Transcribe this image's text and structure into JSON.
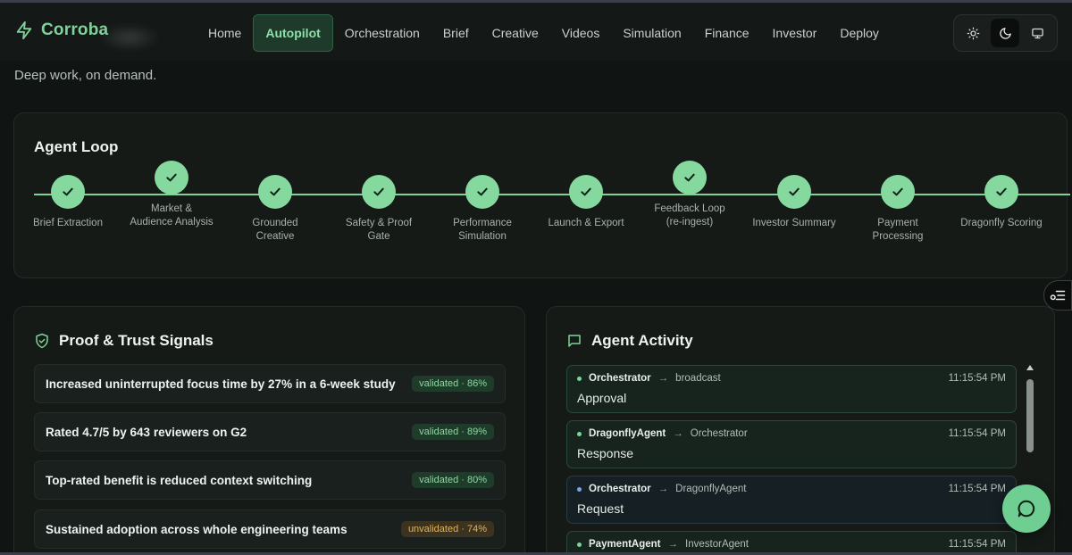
{
  "brand": {
    "name": "Corroba",
    "logo_icon": "zap-icon",
    "accent": "#7fd39a"
  },
  "nav": {
    "items": [
      {
        "label": "Home",
        "active": false
      },
      {
        "label": "Autopilot",
        "active": true
      },
      {
        "label": "Orchestration",
        "active": false
      },
      {
        "label": "Brief",
        "active": false
      },
      {
        "label": "Creative",
        "active": false
      },
      {
        "label": "Videos",
        "active": false
      },
      {
        "label": "Simulation",
        "active": false
      },
      {
        "label": "Finance",
        "active": false
      },
      {
        "label": "Investor",
        "active": false
      },
      {
        "label": "Deploy",
        "active": false
      }
    ]
  },
  "theme": {
    "options": [
      "sun-icon",
      "moon-icon",
      "monitor-icon"
    ],
    "selected": "moon-icon"
  },
  "tagline": "Deep work, on demand.",
  "agent_loop": {
    "title": "Agent Loop",
    "steps": [
      {
        "label": "Brief Extraction",
        "status": "done"
      },
      {
        "label": "Market & Audience Analysis",
        "status": "done"
      },
      {
        "label": "Grounded Creative",
        "status": "done"
      },
      {
        "label": "Safety & Proof Gate",
        "status": "done"
      },
      {
        "label": "Performance Simulation",
        "status": "done"
      },
      {
        "label": "Launch & Export",
        "status": "done"
      },
      {
        "label": "Feedback Loop (re-ingest)",
        "status": "done"
      },
      {
        "label": "Investor Summary",
        "status": "done"
      },
      {
        "label": "Payment Processing",
        "status": "done"
      },
      {
        "label": "Dragonfly Scoring",
        "status": "done"
      }
    ]
  },
  "proof": {
    "title": "Proof & Trust Signals",
    "icon": "shield-check-icon",
    "signals": [
      {
        "text": "Increased uninterrupted focus time by 27% in a 6-week study",
        "badge": "validated · 86%",
        "state": "validated"
      },
      {
        "text": "Rated 4.7/5 by 643 reviewers on G2",
        "badge": "validated · 89%",
        "state": "validated"
      },
      {
        "text": "Top-rated benefit is reduced context switching",
        "badge": "validated · 80%",
        "state": "validated"
      },
      {
        "text": "Sustained adoption across whole engineering teams",
        "badge": "unvalidated · 74%",
        "state": "unvalidated"
      }
    ]
  },
  "activity": {
    "title": "Agent Activity",
    "icon": "message-square-icon",
    "arrow": "→",
    "events": [
      {
        "from": "Orchestrator",
        "to": "broadcast",
        "time": "11:15:54 PM",
        "kind": "Approval",
        "tone": "green"
      },
      {
        "from": "DragonflyAgent",
        "to": "Orchestrator",
        "time": "11:15:54 PM",
        "kind": "Response",
        "tone": "green"
      },
      {
        "from": "Orchestrator",
        "to": "DragonflyAgent",
        "time": "11:15:54 PM",
        "kind": "Request",
        "tone": "blue"
      },
      {
        "from": "PaymentAgent",
        "to": "InvestorAgent",
        "time": "11:15:54 PM",
        "kind": "",
        "tone": "green"
      }
    ]
  },
  "chat_button_icon": "chat-bubble-icon",
  "side_handle_icon": "settings-list-icon"
}
